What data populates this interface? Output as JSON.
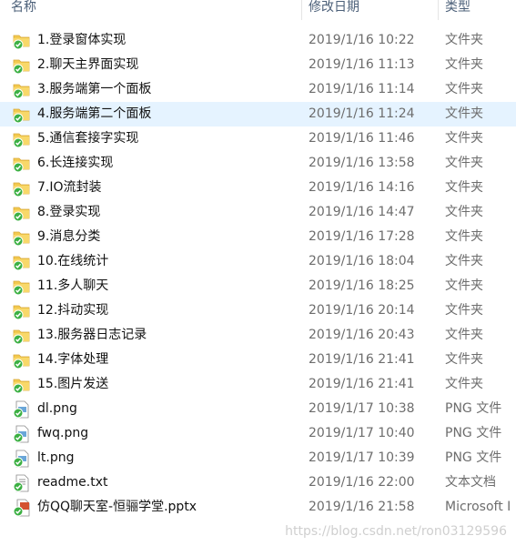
{
  "columns": {
    "name": "名称",
    "date": "修改日期",
    "type": "类型"
  },
  "files": [
    {
      "name": "1.登录窗体实现",
      "date": "2019/1/16 10:22",
      "type": "文件夹",
      "icon": "folder-sync-icon"
    },
    {
      "name": "2.聊天主界面实现",
      "date": "2019/1/16 11:13",
      "type": "文件夹",
      "icon": "folder-sync-icon"
    },
    {
      "name": "3.服务端第一个面板",
      "date": "2019/1/16 11:14",
      "type": "文件夹",
      "icon": "folder-sync-icon"
    },
    {
      "name": "4.服务端第二个面板",
      "date": "2019/1/16 11:24",
      "type": "文件夹",
      "icon": "folder-sync-icon",
      "selected": true
    },
    {
      "name": "5.通信套接字实现",
      "date": "2019/1/16 11:46",
      "type": "文件夹",
      "icon": "folder-sync-icon"
    },
    {
      "name": "6.长连接实现",
      "date": "2019/1/16 13:58",
      "type": "文件夹",
      "icon": "folder-sync-icon"
    },
    {
      "name": "7.IO流封装",
      "date": "2019/1/16 14:16",
      "type": "文件夹",
      "icon": "folder-sync-icon"
    },
    {
      "name": "8.登录实现",
      "date": "2019/1/16 14:47",
      "type": "文件夹",
      "icon": "folder-sync-icon"
    },
    {
      "name": "9.消息分类",
      "date": "2019/1/16 17:28",
      "type": "文件夹",
      "icon": "folder-sync-icon"
    },
    {
      "name": "10.在线统计",
      "date": "2019/1/16 18:04",
      "type": "文件夹",
      "icon": "folder-sync-icon"
    },
    {
      "name": "11.多人聊天",
      "date": "2019/1/16 18:25",
      "type": "文件夹",
      "icon": "folder-sync-icon"
    },
    {
      "name": "12.抖动实现",
      "date": "2019/1/16 20:14",
      "type": "文件夹",
      "icon": "folder-sync-icon"
    },
    {
      "name": "13.服务器日志记录",
      "date": "2019/1/16 20:43",
      "type": "文件夹",
      "icon": "folder-sync-icon"
    },
    {
      "name": "14.字体处理",
      "date": "2019/1/16 21:41",
      "type": "文件夹",
      "icon": "folder-sync-icon"
    },
    {
      "name": "15.图片发送",
      "date": "2019/1/16 21:41",
      "type": "文件夹",
      "icon": "folder-sync-icon"
    },
    {
      "name": "dl.png",
      "date": "2019/1/17 10:38",
      "type": "PNG 文件",
      "icon": "image-file-sync-icon"
    },
    {
      "name": "fwq.png",
      "date": "2019/1/17 10:40",
      "type": "PNG 文件",
      "icon": "image-file-sync-icon"
    },
    {
      "name": "lt.png",
      "date": "2019/1/17 10:39",
      "type": "PNG 文件",
      "icon": "image-file-sync-icon"
    },
    {
      "name": "readme.txt",
      "date": "2019/1/16 22:00",
      "type": "文本文档",
      "icon": "text-file-sync-icon"
    },
    {
      "name": "仿QQ聊天室-恒骊学堂.pptx",
      "date": "2019/1/16 21:58",
      "type": "Microsoft I",
      "icon": "pptx-file-sync-icon"
    }
  ],
  "watermark": "https://blog.csdn.net/ron03129596",
  "colors": {
    "selected_row": "#e5f3ff",
    "header_text": "#4c6079",
    "sync_badge": "#3cb043",
    "folder": "#f3c94f"
  }
}
